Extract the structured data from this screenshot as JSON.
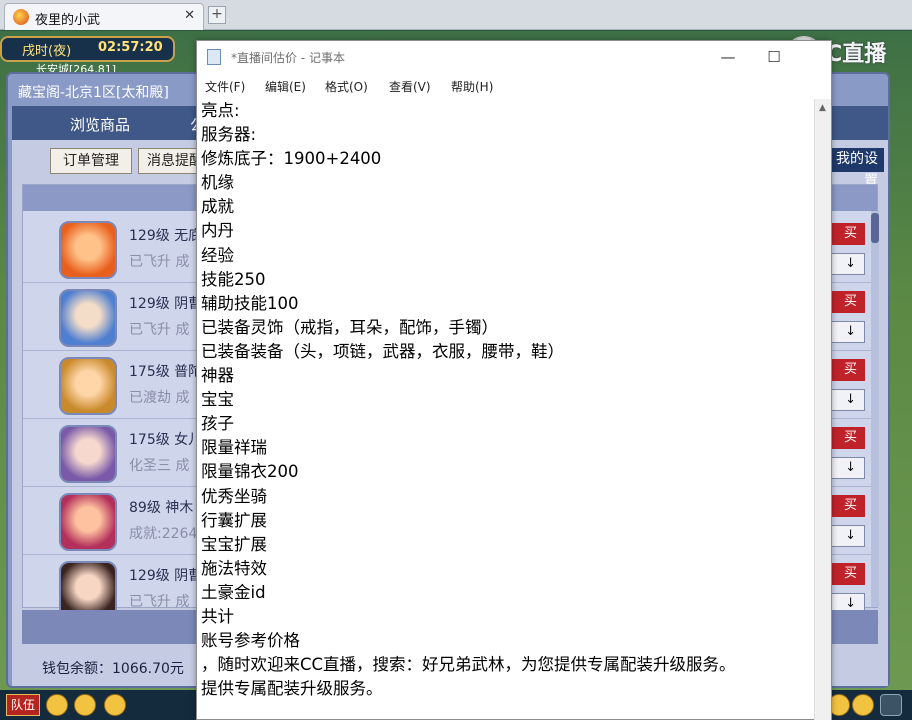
{
  "browser": {
    "tab_title": "夜里的小武",
    "tab_close": "✕",
    "new_tab": "+"
  },
  "game": {
    "time_label": "戌时(夜)",
    "clock": "02:57:20",
    "location": "长安城[264,81]"
  },
  "pavilion": {
    "title": "藏宝阁-北京1区[太和殿]",
    "nav_browse": "浏览商品",
    "nav_other": "公",
    "orders_button": "订单管理",
    "messages_button": "消息提醒",
    "settings_button": "我的设置",
    "buy_label": "买",
    "more_label": "↓",
    "wallet": "钱包余额：1066.70元",
    "rows": [
      {
        "level": "129级  无底",
        "status": "已飞升  成"
      },
      {
        "level": "129级  阴曹",
        "status": "已飞升  成"
      },
      {
        "level": "175级  普陀",
        "status": "已渡劫  成"
      },
      {
        "level": "175级  女儿",
        "status": "化圣三  成"
      },
      {
        "level": "89级  神木",
        "status": "成就:2264"
      },
      {
        "level": "129级  阴曹",
        "status": "已飞升  成"
      }
    ]
  },
  "bottom_bar": {
    "team_label": "队伍"
  },
  "watermark": {
    "text": "CC直播"
  },
  "notepad": {
    "title": "*直播间估价 - 记事本",
    "minimize": "—",
    "maximize": "☐",
    "close": "✕",
    "menus": [
      "文件(F)",
      "编辑(E)",
      "格式(O)",
      "查看(V)",
      "帮助(H)"
    ],
    "lines": [
      "亮点:",
      "服务器:",
      "修炼底子：1900+2400",
      "机缘",
      "成就",
      "内丹",
      "经验",
      "技能250",
      "辅助技能100",
      "已装备灵饰（戒指，耳朵，配饰，手镯）",
      "已装备装备（头，项链，武器，衣服，腰带，鞋）",
      "神器",
      "宝宝",
      "孩子",
      "限量祥瑞",
      "限量锦衣200",
      "优秀坐骑",
      "行囊扩展",
      "宝宝扩展",
      "施法特效",
      "土豪金id",
      "共计",
      "账号参考价格",
      "，随时欢迎来CC直播，搜索：好兄弟武林，为您提供专属配装升级服务。",
      "提供专属配装升级服务。"
    ]
  },
  "colors": {
    "panel_bg": "#8a9ac6",
    "buy_red": "#c0222a",
    "notepad_bg": "#ffffff"
  }
}
